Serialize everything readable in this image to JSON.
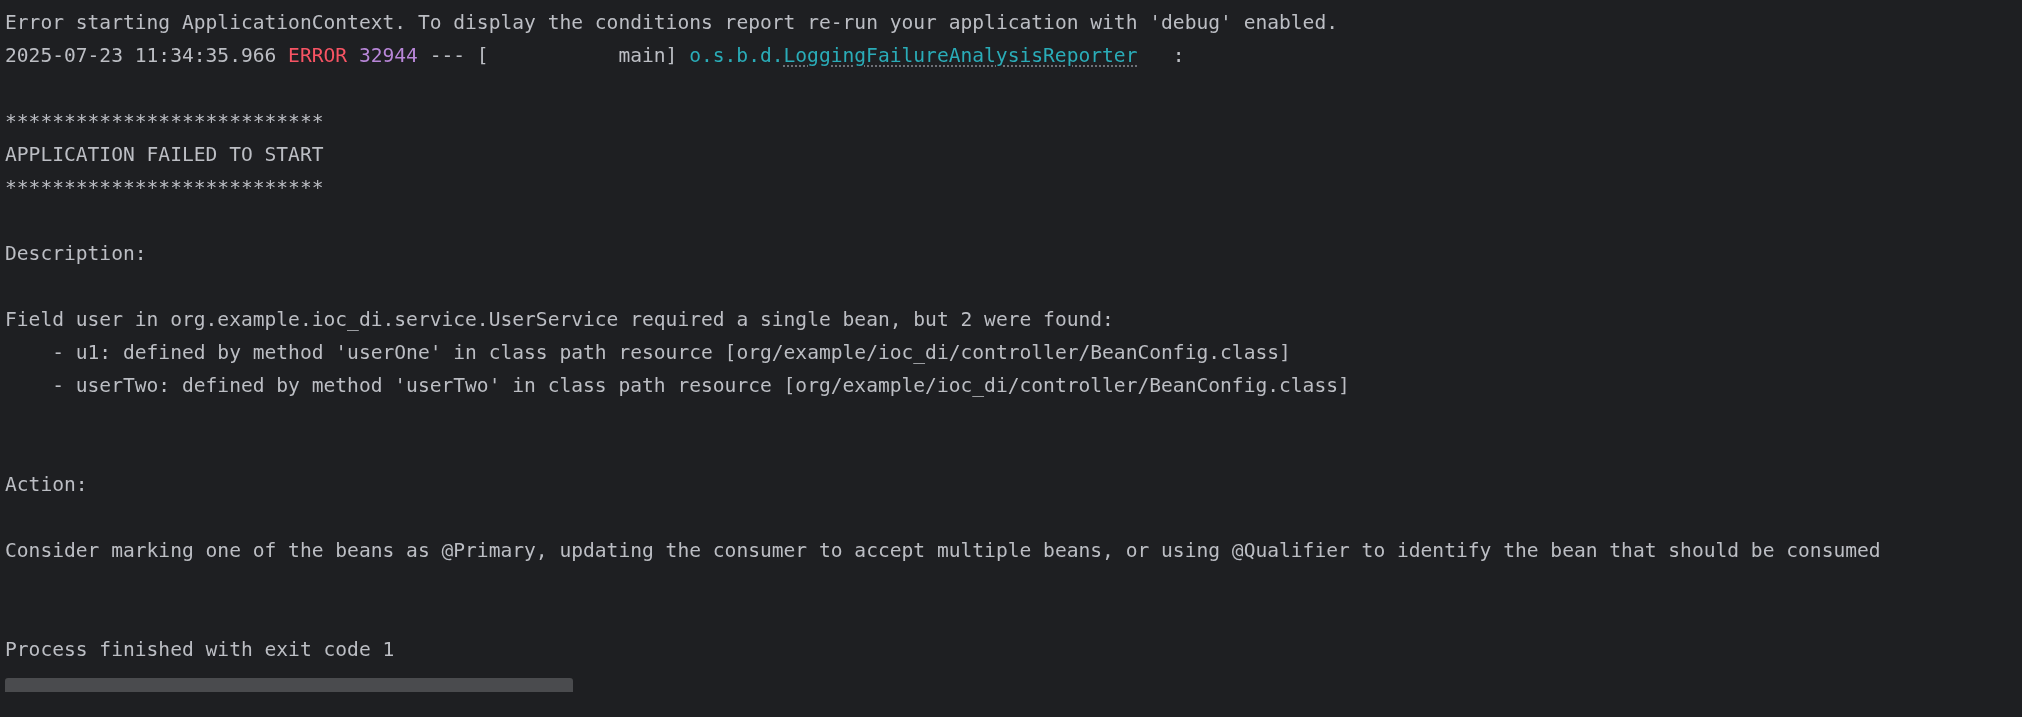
{
  "console": {
    "lines": [
      {
        "kind": "text",
        "text": "Error starting ApplicationContext. To display the conditions report re-run your application with 'debug' enabled."
      },
      {
        "kind": "log",
        "timestamp": "2025-07-23 11:34:35.966",
        "level": "ERROR",
        "pid": "32944",
        "thread": "--- [           main]",
        "logger_package": "o.s.b.d.",
        "logger_class": "LoggingFailureAnalysisReporter",
        "tail": ":"
      },
      {
        "kind": "blank"
      },
      {
        "kind": "text",
        "text": "***************************"
      },
      {
        "kind": "text",
        "text": "APPLICATION FAILED TO START"
      },
      {
        "kind": "text",
        "text": "***************************"
      },
      {
        "kind": "blank"
      },
      {
        "kind": "text",
        "text": "Description:"
      },
      {
        "kind": "blank"
      },
      {
        "kind": "text",
        "text": "Field user in org.example.ioc_di.service.UserService required a single bean, but 2 were found:"
      },
      {
        "kind": "text",
        "text": "    - u1: defined by method 'userOne' in class path resource [org/example/ioc_di/controller/BeanConfig.class]"
      },
      {
        "kind": "text",
        "text": "    - userTwo: defined by method 'userTwo' in class path resource [org/example/ioc_di/controller/BeanConfig.class]"
      },
      {
        "kind": "blank"
      },
      {
        "kind": "blank"
      },
      {
        "kind": "text",
        "text": "Action:"
      },
      {
        "kind": "blank"
      },
      {
        "kind": "text",
        "text": "Consider marking one of the beans as @Primary, updating the consumer to accept multiple beans, or using @Qualifier to identify the bean that should be consumed"
      },
      {
        "kind": "blank"
      },
      {
        "kind": "blank"
      },
      {
        "kind": "text",
        "text": "Process finished with exit code 1"
      }
    ]
  }
}
